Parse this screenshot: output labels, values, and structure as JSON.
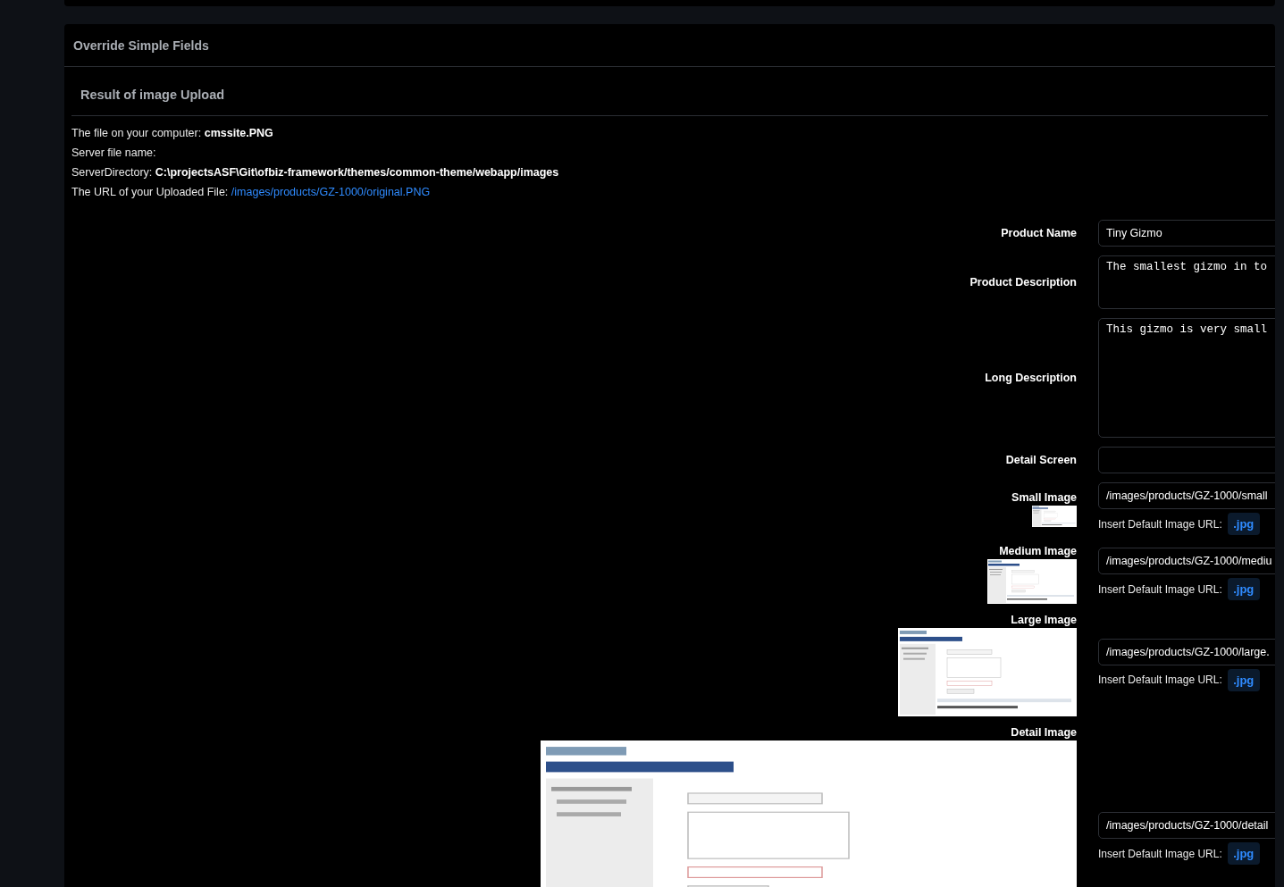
{
  "panel_title": "Override Simple Fields",
  "section_title": "Result of image Upload",
  "upload_info": [
    {
      "label": "The file on your computer:",
      "value": "cmssite.PNG",
      "kind": "bold"
    },
    {
      "label": "Server file name:",
      "kind": "plain"
    },
    {
      "label": "ServerDirectory:",
      "value": "C:\\projectsASF\\Git\\ofbiz-framework/themes/common-theme/webapp/images",
      "kind": "bold"
    },
    {
      "label": "The URL of your Uploaded File:",
      "value": "/images/products/GZ-1000/original.PNG",
      "kind": "link"
    }
  ],
  "fields": [
    {
      "label": "Product Name",
      "kind": "input",
      "value": "Tiny Gizmo"
    },
    {
      "label": "Product Description",
      "kind": "textarea",
      "value": "The smallest gizmo in to"
    },
    {
      "label": "Long Description",
      "kind": "longtext",
      "value": "This gizmo is very small"
    },
    {
      "label": "Detail Screen",
      "kind": "input"
    },
    {
      "label": "Small Image",
      "value": "/images/products/GZ-1000/small",
      "insert_label": "Insert Default Image URL:",
      "button": ".jpg"
    },
    {
      "label": "Medium Image",
      "value": "/images/products/GZ-1000/mediu",
      "insert_label": "Insert Default Image URL:",
      "button": ".jpg"
    },
    {
      "label": "Large Image",
      "value": "/images/products/GZ-1000/large.",
      "insert_label": "Insert Default Image URL:",
      "button": ".jpg"
    },
    {
      "label": "Detail Image",
      "value": "/images/products/GZ-1000/detail",
      "insert_label": "Insert Default Image URL:",
      "button": ".jpg"
    }
  ]
}
